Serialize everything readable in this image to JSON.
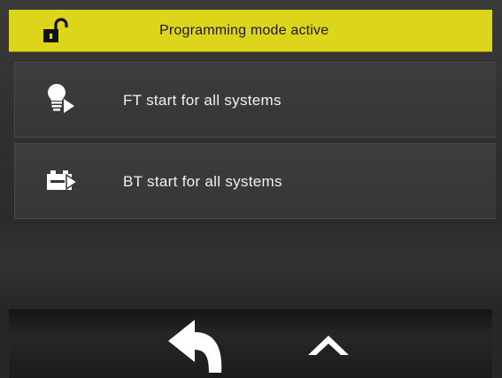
{
  "header": {
    "title": "Programming mode active",
    "lock_icon": "unlocked-padlock-icon",
    "background_color": "#ddd41c"
  },
  "menu": {
    "items": [
      {
        "label": "FT start for all systems",
        "icon": "lightbulb-play-icon"
      },
      {
        "label": "BT start for all systems",
        "icon": "battery-play-icon"
      }
    ]
  },
  "footer": {
    "back_icon": "back-arrow-icon",
    "up_icon": "chevron-up-icon"
  }
}
